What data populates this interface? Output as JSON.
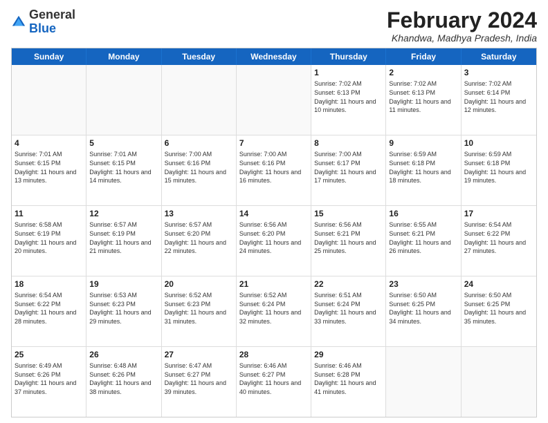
{
  "header": {
    "logo": {
      "line1": "General",
      "line2": "Blue"
    },
    "title": "February 2024",
    "location": "Khandwa, Madhya Pradesh, India"
  },
  "weekdays": [
    "Sunday",
    "Monday",
    "Tuesday",
    "Wednesday",
    "Thursday",
    "Friday",
    "Saturday"
  ],
  "weeks": [
    [
      {
        "day": "",
        "empty": true
      },
      {
        "day": "",
        "empty": true
      },
      {
        "day": "",
        "empty": true
      },
      {
        "day": "",
        "empty": true
      },
      {
        "day": "1",
        "sunrise": "7:02 AM",
        "sunset": "6:13 PM",
        "daylight": "11 hours and 10 minutes."
      },
      {
        "day": "2",
        "sunrise": "7:02 AM",
        "sunset": "6:13 PM",
        "daylight": "11 hours and 11 minutes."
      },
      {
        "day": "3",
        "sunrise": "7:02 AM",
        "sunset": "6:14 PM",
        "daylight": "11 hours and 12 minutes."
      }
    ],
    [
      {
        "day": "4",
        "sunrise": "7:01 AM",
        "sunset": "6:15 PM",
        "daylight": "11 hours and 13 minutes."
      },
      {
        "day": "5",
        "sunrise": "7:01 AM",
        "sunset": "6:15 PM",
        "daylight": "11 hours and 14 minutes."
      },
      {
        "day": "6",
        "sunrise": "7:00 AM",
        "sunset": "6:16 PM",
        "daylight": "11 hours and 15 minutes."
      },
      {
        "day": "7",
        "sunrise": "7:00 AM",
        "sunset": "6:16 PM",
        "daylight": "11 hours and 16 minutes."
      },
      {
        "day": "8",
        "sunrise": "7:00 AM",
        "sunset": "6:17 PM",
        "daylight": "11 hours and 17 minutes."
      },
      {
        "day": "9",
        "sunrise": "6:59 AM",
        "sunset": "6:18 PM",
        "daylight": "11 hours and 18 minutes."
      },
      {
        "day": "10",
        "sunrise": "6:59 AM",
        "sunset": "6:18 PM",
        "daylight": "11 hours and 19 minutes."
      }
    ],
    [
      {
        "day": "11",
        "sunrise": "6:58 AM",
        "sunset": "6:19 PM",
        "daylight": "11 hours and 20 minutes."
      },
      {
        "day": "12",
        "sunrise": "6:57 AM",
        "sunset": "6:19 PM",
        "daylight": "11 hours and 21 minutes."
      },
      {
        "day": "13",
        "sunrise": "6:57 AM",
        "sunset": "6:20 PM",
        "daylight": "11 hours and 22 minutes."
      },
      {
        "day": "14",
        "sunrise": "6:56 AM",
        "sunset": "6:20 PM",
        "daylight": "11 hours and 24 minutes."
      },
      {
        "day": "15",
        "sunrise": "6:56 AM",
        "sunset": "6:21 PM",
        "daylight": "11 hours and 25 minutes."
      },
      {
        "day": "16",
        "sunrise": "6:55 AM",
        "sunset": "6:21 PM",
        "daylight": "11 hours and 26 minutes."
      },
      {
        "day": "17",
        "sunrise": "6:54 AM",
        "sunset": "6:22 PM",
        "daylight": "11 hours and 27 minutes."
      }
    ],
    [
      {
        "day": "18",
        "sunrise": "6:54 AM",
        "sunset": "6:22 PM",
        "daylight": "11 hours and 28 minutes."
      },
      {
        "day": "19",
        "sunrise": "6:53 AM",
        "sunset": "6:23 PM",
        "daylight": "11 hours and 29 minutes."
      },
      {
        "day": "20",
        "sunrise": "6:52 AM",
        "sunset": "6:23 PM",
        "daylight": "11 hours and 31 minutes."
      },
      {
        "day": "21",
        "sunrise": "6:52 AM",
        "sunset": "6:24 PM",
        "daylight": "11 hours and 32 minutes."
      },
      {
        "day": "22",
        "sunrise": "6:51 AM",
        "sunset": "6:24 PM",
        "daylight": "11 hours and 33 minutes."
      },
      {
        "day": "23",
        "sunrise": "6:50 AM",
        "sunset": "6:25 PM",
        "daylight": "11 hours and 34 minutes."
      },
      {
        "day": "24",
        "sunrise": "6:50 AM",
        "sunset": "6:25 PM",
        "daylight": "11 hours and 35 minutes."
      }
    ],
    [
      {
        "day": "25",
        "sunrise": "6:49 AM",
        "sunset": "6:26 PM",
        "daylight": "11 hours and 37 minutes."
      },
      {
        "day": "26",
        "sunrise": "6:48 AM",
        "sunset": "6:26 PM",
        "daylight": "11 hours and 38 minutes."
      },
      {
        "day": "27",
        "sunrise": "6:47 AM",
        "sunset": "6:27 PM",
        "daylight": "11 hours and 39 minutes."
      },
      {
        "day": "28",
        "sunrise": "6:46 AM",
        "sunset": "6:27 PM",
        "daylight": "11 hours and 40 minutes."
      },
      {
        "day": "29",
        "sunrise": "6:46 AM",
        "sunset": "6:28 PM",
        "daylight": "11 hours and 41 minutes."
      },
      {
        "day": "",
        "empty": true
      },
      {
        "day": "",
        "empty": true
      }
    ]
  ]
}
